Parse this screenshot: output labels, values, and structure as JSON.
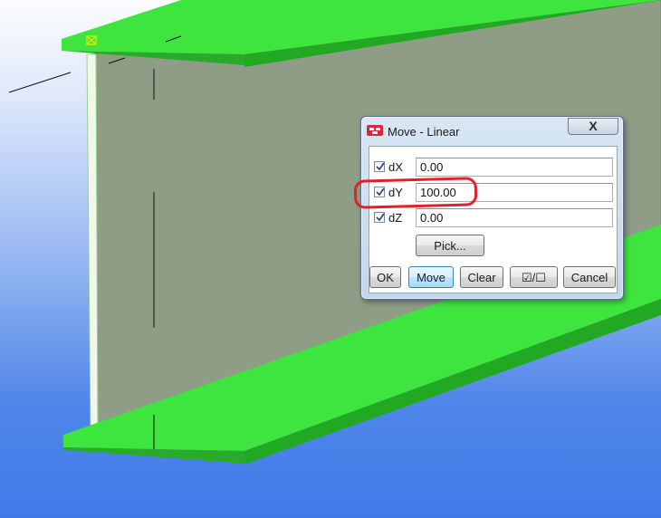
{
  "dialog": {
    "title": "Move - Linear",
    "close_glyph": "X",
    "rows": [
      {
        "label": "dX",
        "checked": true,
        "value": "0.00"
      },
      {
        "label": "dY",
        "checked": true,
        "value": "100.00"
      },
      {
        "label": "dZ",
        "checked": true,
        "value": "0.00"
      }
    ],
    "pick_label": "Pick...",
    "buttons": {
      "ok": "OK",
      "move": "Move",
      "clear": "Clear",
      "toggle_all": "☑/☐",
      "cancel": "Cancel"
    }
  },
  "annotation": {
    "highlight_color": "#e3202a",
    "highlighted_row": "dY"
  },
  "viewport": {
    "flange_color": "#3ee53e",
    "web_color": "#8f9c86",
    "background_top": "#fbfcff",
    "background_bottom": "#3f7be8"
  },
  "icons": {
    "app": "app-icon",
    "close": "close-icon",
    "checkbox": "checkmark-icon"
  }
}
